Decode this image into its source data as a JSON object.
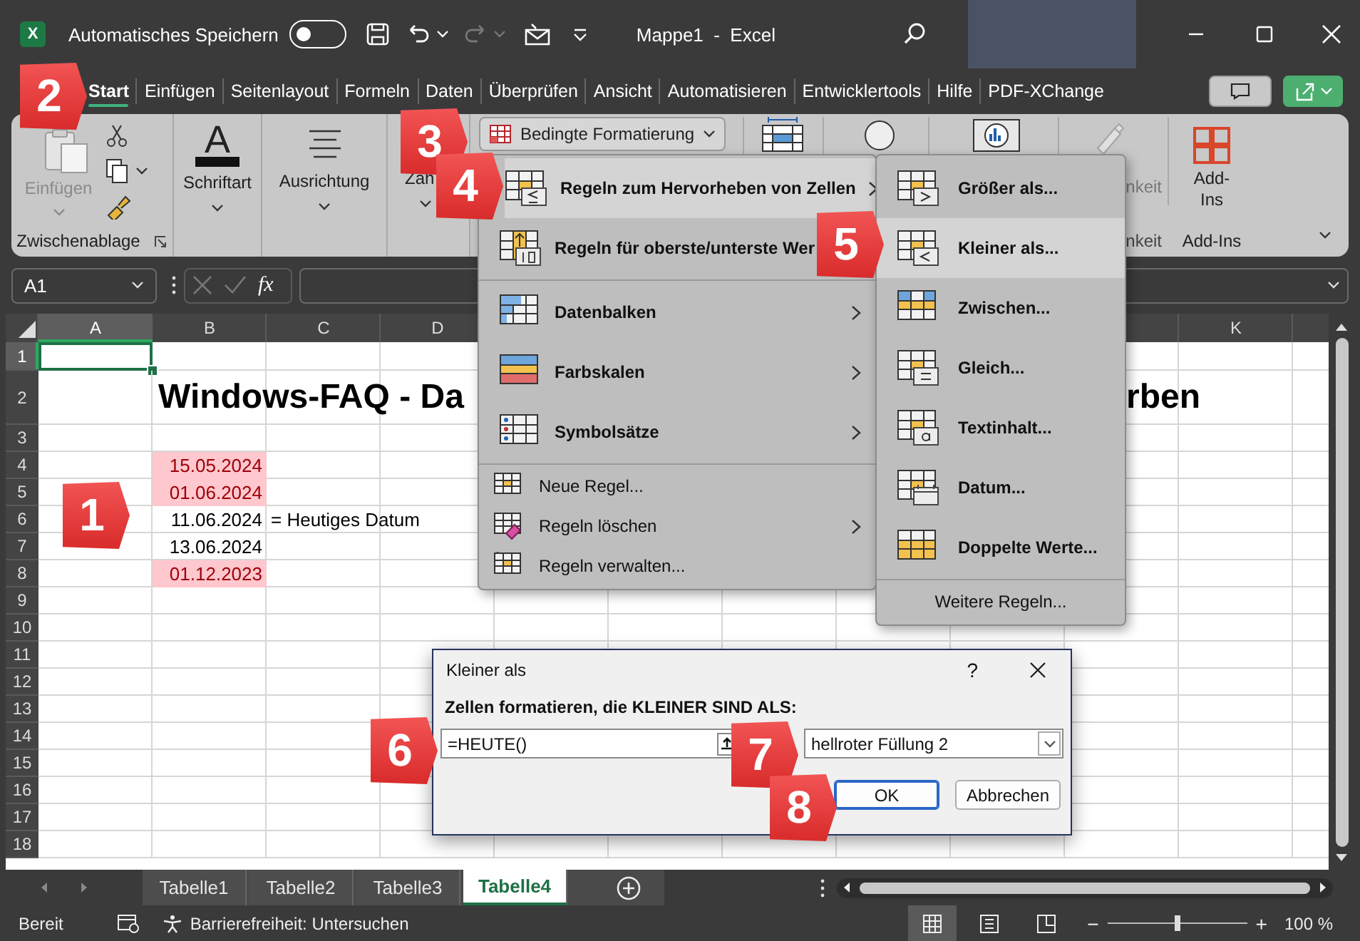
{
  "title_bar": {
    "logo_letter": "X",
    "autosave_label": "Automatisches Speichern",
    "autosave_on": false,
    "document_title": "Mappe1  -  Excel"
  },
  "ribbon_tabs": [
    {
      "label": "Start",
      "selected": true
    },
    {
      "label": "Einfügen",
      "selected": false
    },
    {
      "label": "Seitenlayout",
      "selected": false
    },
    {
      "label": "Formeln",
      "selected": false
    },
    {
      "label": "Daten",
      "selected": false
    },
    {
      "label": "Überprüfen",
      "selected": false
    },
    {
      "label": "Ansicht",
      "selected": false
    },
    {
      "label": "Automatisieren",
      "selected": false
    },
    {
      "label": "Entwicklertools",
      "selected": false
    },
    {
      "label": "Hilfe",
      "selected": false
    },
    {
      "label": "PDF-XChange",
      "selected": false
    }
  ],
  "ribbon": {
    "paste_label": "Einfügen",
    "clipboard_group": "Zwischenablage",
    "font_icon_letter": "A",
    "font_label": "Schriftart",
    "alignment_label": "Ausrichtung",
    "number_label_part": "Zah",
    "conditional_formatting": "Bedingte Formatierung",
    "hidden_button_label_part": "nkeit",
    "hidden_group_label_part": "nkeit",
    "addins_label": "Add-Ins",
    "addins_group": "Add-Ins"
  },
  "formula_bar": {
    "name_box": "A1",
    "function_label": "fx"
  },
  "sheet": {
    "columns": [
      "A",
      "B",
      "C",
      "D",
      "K"
    ],
    "rows": [
      {
        "number": "1",
        "a_active": true
      },
      {
        "number": "2",
        "a_active": false,
        "title": "Windows-FAQ - Da",
        "title_end": "rben"
      },
      {
        "number": "3",
        "a_active": false
      },
      {
        "number": "4",
        "a_active": false,
        "column_b": {
          "text": "15.05.2024",
          "highlighted": true
        }
      },
      {
        "number": "5",
        "a_active": false,
        "column_b": {
          "text": "01.06.2024",
          "highlighted": true
        }
      },
      {
        "number": "6",
        "a_active": false,
        "column_b": {
          "text": "11.06.2024",
          "highlighted": false
        },
        "column_c": "= Heutiges Datum"
      },
      {
        "number": "7",
        "a_active": false,
        "column_b": {
          "text": "13.06.2024",
          "highlighted": false
        }
      },
      {
        "number": "8",
        "a_active": false,
        "column_b": {
          "text": "01.12.2023",
          "highlighted": true
        }
      },
      {
        "number": "9",
        "a_active": false
      },
      {
        "number": "10",
        "a_active": false
      },
      {
        "number": "11",
        "a_active": false
      },
      {
        "number": "12",
        "a_active": false
      },
      {
        "number": "13",
        "a_active": false
      },
      {
        "number": "14",
        "a_active": false
      },
      {
        "number": "15",
        "a_active": false
      },
      {
        "number": "16",
        "a_active": false
      },
      {
        "number": "17",
        "a_active": false
      },
      {
        "number": "18",
        "a_active": false
      }
    ]
  },
  "conditional_menu": {
    "items": [
      {
        "kind": "large",
        "label": "Regeln zum Hervorheben von Zellen",
        "has_submenu": true,
        "selected": true
      },
      {
        "kind": "large",
        "label": "Regeln für oberste/unterste Wer",
        "selected": false
      },
      {
        "kind": "separator"
      },
      {
        "kind": "large",
        "label": "Datenbalken",
        "has_submenu": true,
        "selected": false
      },
      {
        "kind": "large",
        "label": "Farbskalen",
        "has_submenu": true,
        "selected": false
      },
      {
        "kind": "large",
        "label": "Symbolsätze",
        "has_submenu": true,
        "selected": false
      },
      {
        "kind": "separator"
      },
      {
        "kind": "small",
        "label": "Neue Regel...",
        "has_submenu": false,
        "selected": false
      },
      {
        "kind": "small",
        "label": "Regeln löschen",
        "has_submenu": true,
        "selected": false
      },
      {
        "kind": "small",
        "label": "Regeln verwalten...",
        "has_submenu": false,
        "selected": false
      }
    ]
  },
  "submenu": {
    "items": [
      {
        "label": "Größer als...",
        "selected": false
      },
      {
        "label": "Kleiner als...",
        "selected": true
      },
      {
        "label": "Zwischen...",
        "selected": false
      },
      {
        "label": "Gleich...",
        "selected": false
      },
      {
        "label": "Textinhalt...",
        "selected": false
      },
      {
        "label": "Datum...",
        "selected": false
      },
      {
        "label": "Doppelte Werte...",
        "selected": false
      }
    ],
    "footer": "Weitere Regeln..."
  },
  "dialog": {
    "title": "Kleiner als",
    "help": "?",
    "prompt": "Zellen formatieren, die KLEINER SIND ALS:",
    "value": "=HEUTE()",
    "format": "hellroter Füllung 2",
    "buttons": [
      {
        "label": "OK",
        "default": true
      },
      {
        "label": "Abbrechen",
        "default": false
      }
    ]
  },
  "sheet_tabs": [
    {
      "label": "Tabelle1",
      "selected": false
    },
    {
      "label": "Tabelle2",
      "selected": false
    },
    {
      "label": "Tabelle3",
      "selected": false
    },
    {
      "label": "Tabelle4",
      "selected": true
    }
  ],
  "status_bar": {
    "ready": "Bereit",
    "accessibility": "Barrierefreiheit: Untersuchen",
    "views": [
      {
        "selected": true
      },
      {
        "selected": false
      },
      {
        "selected": false
      }
    ],
    "zoom_out": "−",
    "zoom_in": "+",
    "zoom": {
      "level": 0.5
    },
    "zoom_label": "100 %"
  },
  "callouts": [
    {
      "number": "1"
    },
    {
      "number": "2"
    },
    {
      "number": "3"
    },
    {
      "number": "4"
    },
    {
      "number": "5"
    },
    {
      "number": "6"
    },
    {
      "number": "7"
    },
    {
      "number": "8"
    }
  ]
}
